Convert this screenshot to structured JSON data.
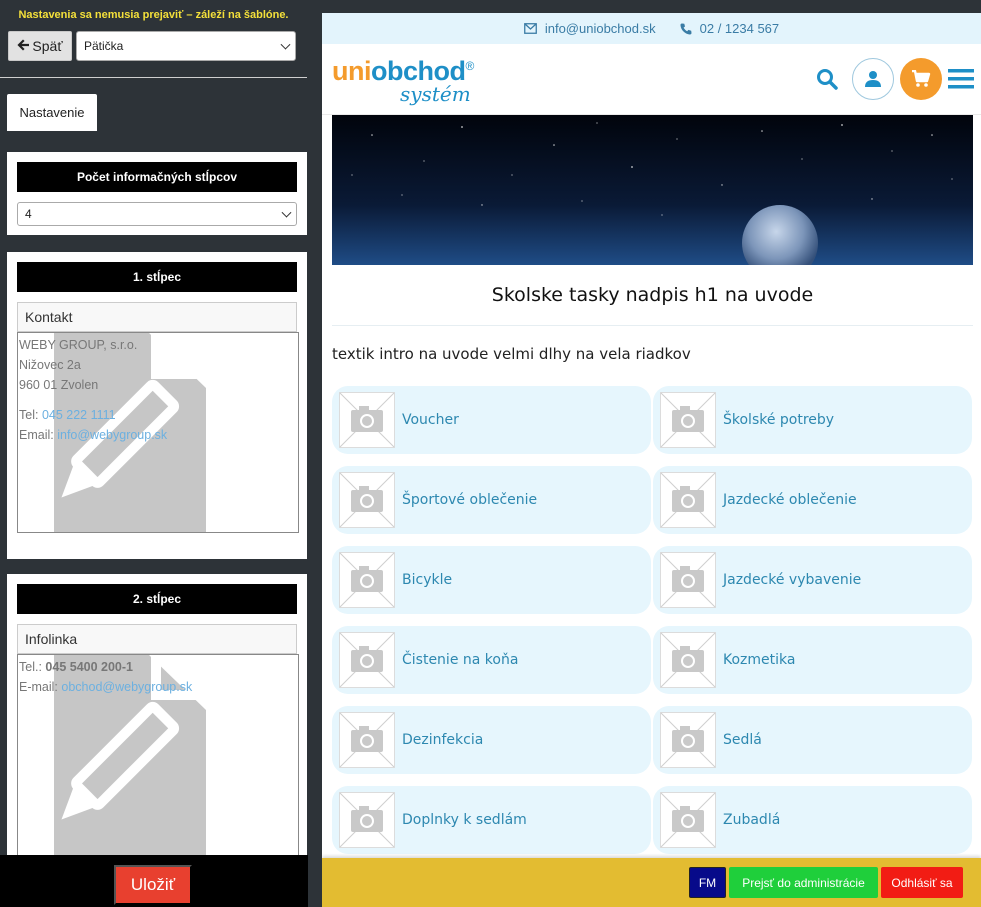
{
  "editor": {
    "warning": "Nastavenia sa nemusia prejaviť – záleží na šablóne.",
    "back_label": "Späť",
    "section_select": "Pätička",
    "tab_label": "Nastavenie",
    "columns_card": {
      "heading": "Počet informačných stĺpcov",
      "value": "4"
    },
    "column1": {
      "heading": "1. stĺpec",
      "title": "Kontakt",
      "company": "WEBY GROUP, s.r.o.",
      "street": "Nižovec 2a",
      "city": "960 01 Zvolen",
      "tel_label": "Tel:",
      "tel": "045 222 1111",
      "email_label": "Email:",
      "email": "info@webygroup.sk"
    },
    "column2": {
      "heading": "2. stĺpec",
      "title": "Infolinka",
      "tel_label": "Tel.:",
      "tel": "045 5400 200-1",
      "email_label": "E-mail:",
      "email": "obchod@webygroup.sk"
    },
    "save_label": "Uložiť"
  },
  "preview": {
    "topbar": {
      "email": "info@uniobchod.sk",
      "phone": "02 / 1234 567"
    },
    "logo": {
      "line1_a": "uni",
      "line1_b": "obchod",
      "reg": "®",
      "line2": "systém"
    },
    "h1": "Skolske tasky nadpis h1 na uvode",
    "intro": "textik intro na uvode velmi dlhy na vela riadkov",
    "categories": [
      "Voucher",
      "Školské potreby",
      "Športové oblečenie",
      "Jazdecké oblečenie",
      "Bicykle",
      "Jazdecké vybavenie",
      "Čistenie na koňa",
      "Kozmetika",
      "Dezinfekcia",
      "Sedlá",
      "Doplnky k sedlám",
      "Zubadlá"
    ],
    "adminbar": {
      "fm": "FM",
      "admin": "Prejsť do administrácie",
      "logout": "Odhlásiť sa"
    }
  },
  "colors": {
    "accent_blue": "#2d88b0",
    "logo_orange": "#f49b2c",
    "save_red": "#e8402f",
    "admin_green": "#1fcf3b",
    "logout_red": "#f21c14",
    "fm_navy": "#070a8a",
    "adminbar_yellow": "#e3bc31"
  }
}
